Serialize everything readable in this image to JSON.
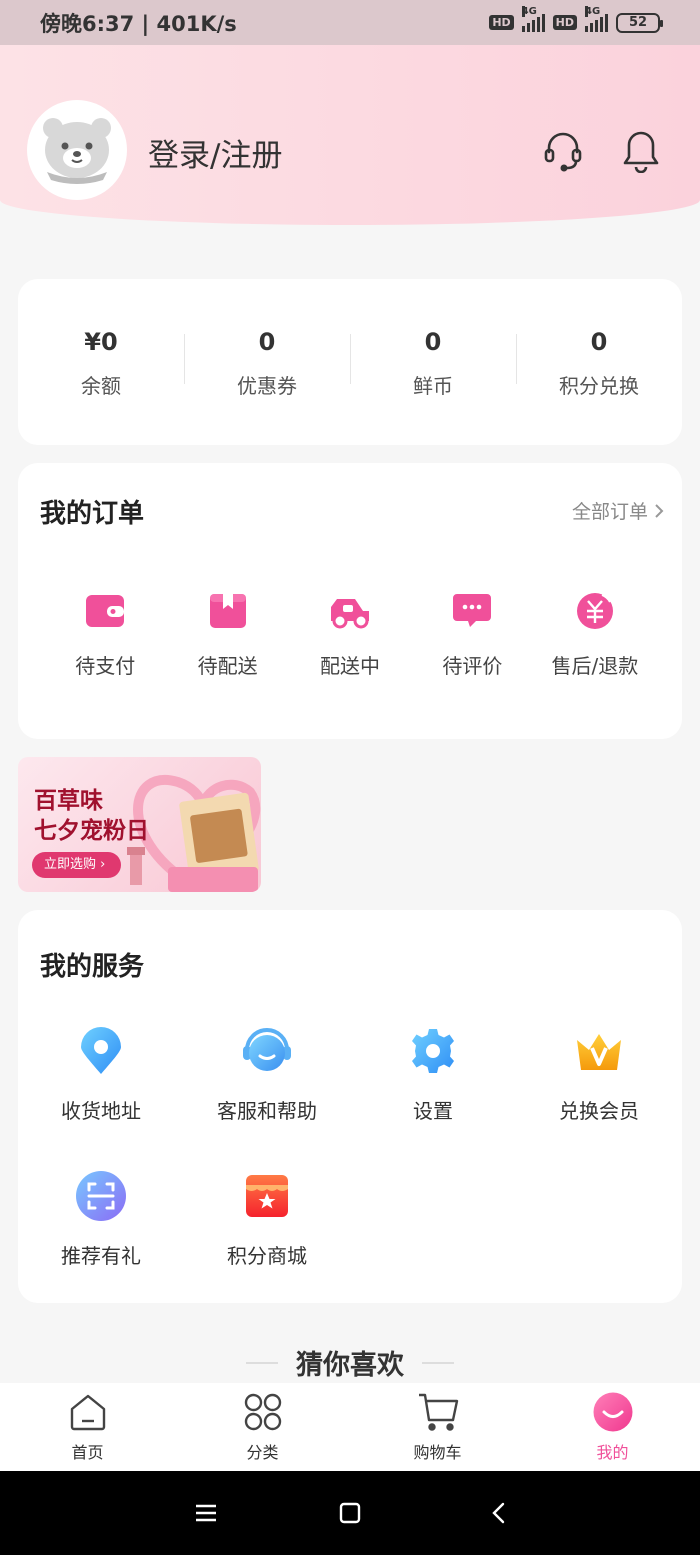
{
  "status_bar": {
    "time_speed": "傍晚6:37 | 401K/s",
    "hd_badge": "HD",
    "network_type": "4G",
    "battery": "52"
  },
  "header": {
    "login_text": "登录/注册",
    "support_icon": "headset-icon",
    "notification_icon": "bell-icon"
  },
  "assets": [
    {
      "value": "¥0",
      "label": "余额"
    },
    {
      "value": "0",
      "label": "优惠券"
    },
    {
      "value": "0",
      "label": "鲜币"
    },
    {
      "value": "0",
      "label": "积分兑换"
    }
  ],
  "orders": {
    "title": "我的订单",
    "all_link": "全部订单",
    "items": [
      {
        "label": "待支付",
        "icon": "wallet-icon"
      },
      {
        "label": "待配送",
        "icon": "package-icon"
      },
      {
        "label": "配送中",
        "icon": "delivery-scooter-icon"
      },
      {
        "label": "待评价",
        "icon": "comment-icon"
      },
      {
        "label": "售后/退款",
        "icon": "refund-icon"
      }
    ]
  },
  "banner": {
    "headline_1": "百草味",
    "headline_2": "七夕宠粉日",
    "cta": "立即选购"
  },
  "services": {
    "title": "我的服务",
    "items": [
      {
        "label": "收货地址",
        "icon": "location-pin-icon"
      },
      {
        "label": "客服和帮助",
        "icon": "customer-service-icon"
      },
      {
        "label": "设置",
        "icon": "settings-gear-icon"
      },
      {
        "label": "兑换会员",
        "icon": "vip-crown-icon"
      },
      {
        "label": "推荐有礼",
        "icon": "scan-icon"
      },
      {
        "label": "积分商城",
        "icon": "store-icon"
      }
    ]
  },
  "guess_title": "猜你喜欢",
  "tabbar": {
    "items": [
      {
        "label": "首页",
        "icon": "home-icon"
      },
      {
        "label": "分类",
        "icon": "category-grid-icon"
      },
      {
        "label": "购物车",
        "icon": "cart-icon"
      },
      {
        "label": "我的",
        "icon": "profile-smile-icon"
      }
    ],
    "active_color": "#f0509a"
  },
  "colors": {
    "accent_pink": "#f0509a",
    "header_pink": "#fbd2dc"
  }
}
